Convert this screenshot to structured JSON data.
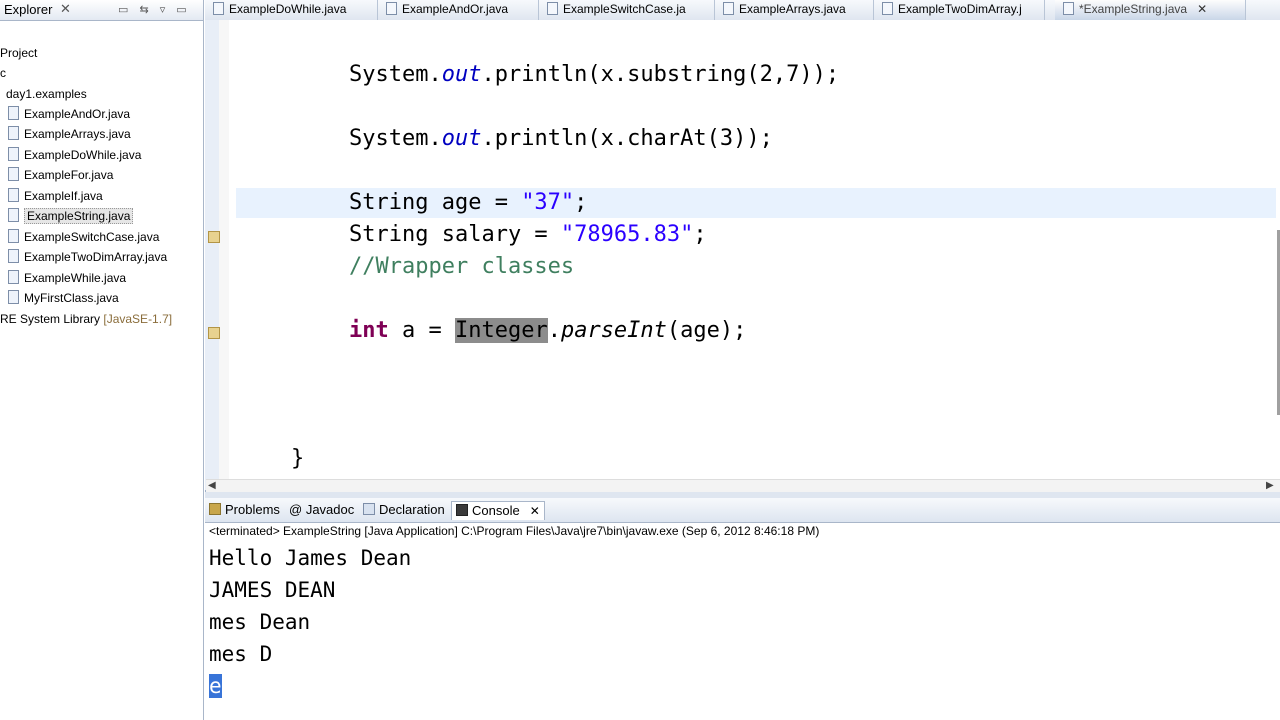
{
  "explorer": {
    "title": "Explorer",
    "close": "✕",
    "items": [
      {
        "label": "Project",
        "indent": 0
      },
      {
        "label": "c",
        "indent": 0
      },
      {
        "label": "day1.examples",
        "indent": 1
      },
      {
        "label": "ExampleAndOr.java",
        "indent": 2
      },
      {
        "label": "ExampleArrays.java",
        "indent": 2
      },
      {
        "label": "ExampleDoWhile.java",
        "indent": 2
      },
      {
        "label": "ExampleFor.java",
        "indent": 2
      },
      {
        "label": "ExampleIf.java",
        "indent": 2
      },
      {
        "label": "ExampleString.java",
        "indent": 2,
        "selected": true
      },
      {
        "label": "ExampleSwitchCase.java",
        "indent": 2
      },
      {
        "label": "ExampleTwoDimArray.java",
        "indent": 2
      },
      {
        "label": "ExampleWhile.java",
        "indent": 2
      },
      {
        "label": "MyFirstClass.java",
        "indent": 2
      },
      {
        "label": "RE System Library",
        "suffix": "[JavaSE-1.7]",
        "indent": 0
      }
    ]
  },
  "tabs": [
    {
      "label": "ExampleDoWhile.java"
    },
    {
      "label": "ExampleAndOr.java"
    },
    {
      "label": "ExampleSwitchCase.ja"
    },
    {
      "label": "ExampleArrays.java"
    },
    {
      "label": "ExampleTwoDimArray.j"
    },
    {
      "label": "*ExampleString.java",
      "active": true,
      "close": "✕"
    }
  ],
  "code": {
    "line1": {
      "a": "System.",
      "b": "out",
      "c": ".println(x.substring(2,7));"
    },
    "line2": {
      "a": "System.",
      "b": "out",
      "c": ".println(x.charAt(3));"
    },
    "line3": {
      "a": "String age = ",
      "b": "\"37\"",
      "c": ";"
    },
    "line4": {
      "a": "String salary = ",
      "b": "\"78965.83\"",
      "c": ";"
    },
    "line5": {
      "comment": "//Wrapper classes"
    },
    "line6": {
      "kw": "int",
      "a": " a = ",
      "hl": "Integer",
      "b": ".",
      "m": "parseInt",
      "c": "(age);"
    },
    "line7": {
      "brace": "}"
    }
  },
  "console": {
    "tabs": [
      "Problems",
      "Javadoc",
      "Declaration",
      "Console"
    ],
    "tab_close": "✕",
    "status": "<terminated> ExampleString [Java Application] C:\\Program Files\\Java\\jre7\\bin\\javaw.exe (Sep 6, 2012 8:46:18 PM)",
    "output": [
      "Hello James Dean",
      "JAMES DEAN",
      "mes Dean",
      "mes D",
      "e"
    ]
  },
  "colors": {
    "keyword": "#7f0055",
    "string": "#2a00ff",
    "comment": "#3f7f5f",
    "field": "#0000c0",
    "selection": "#3874d8"
  }
}
